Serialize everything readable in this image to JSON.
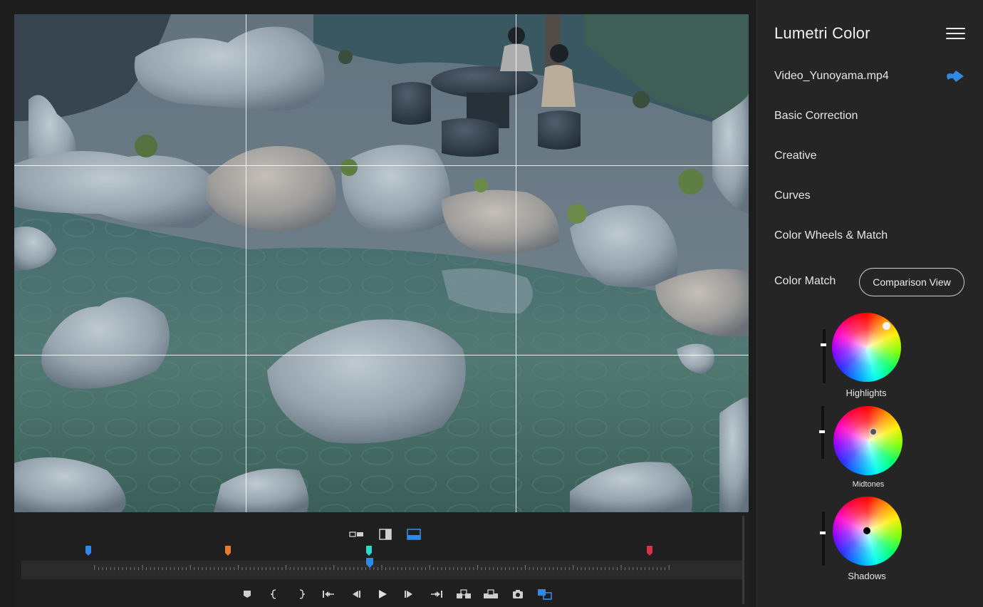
{
  "panel": {
    "title": "Lumetri Color",
    "file_name": "Video_Yunoyama.mp4",
    "sections": [
      "Basic Correction",
      "Creative",
      "Curves",
      "Color Wheels & Match"
    ],
    "color_match_label": "Color Match",
    "comparison_button": "Comparison View",
    "wheels": [
      {
        "label": "Highlights"
      },
      {
        "label": "Midtones"
      },
      {
        "label": "Shadows"
      }
    ]
  },
  "transport": {
    "view_modes": [
      "side-by-side-icon",
      "split-view-icon",
      "wipe-view-icon"
    ],
    "active_view_mode": "wipe-view-icon",
    "markers": [
      {
        "color": "#2f8ae6"
      },
      {
        "color": "#e87a2e"
      },
      {
        "color": "#2fd9c9"
      },
      {
        "color": "#d6324a"
      }
    ],
    "playhead_color": "#2f8ae6",
    "controls": [
      "add-marker-icon",
      "mark-in-icon",
      "mark-out-icon",
      "go-to-in-icon",
      "step-back-icon",
      "play-icon",
      "step-forward-icon",
      "go-to-out-icon",
      "insert-icon",
      "overwrite-icon",
      "export-frame-icon",
      "comparison-toggle-icon"
    ]
  },
  "colors": {
    "accent": "#2f8ae6",
    "panel_bg": "#252525",
    "app_bg": "#1d1d1d"
  }
}
